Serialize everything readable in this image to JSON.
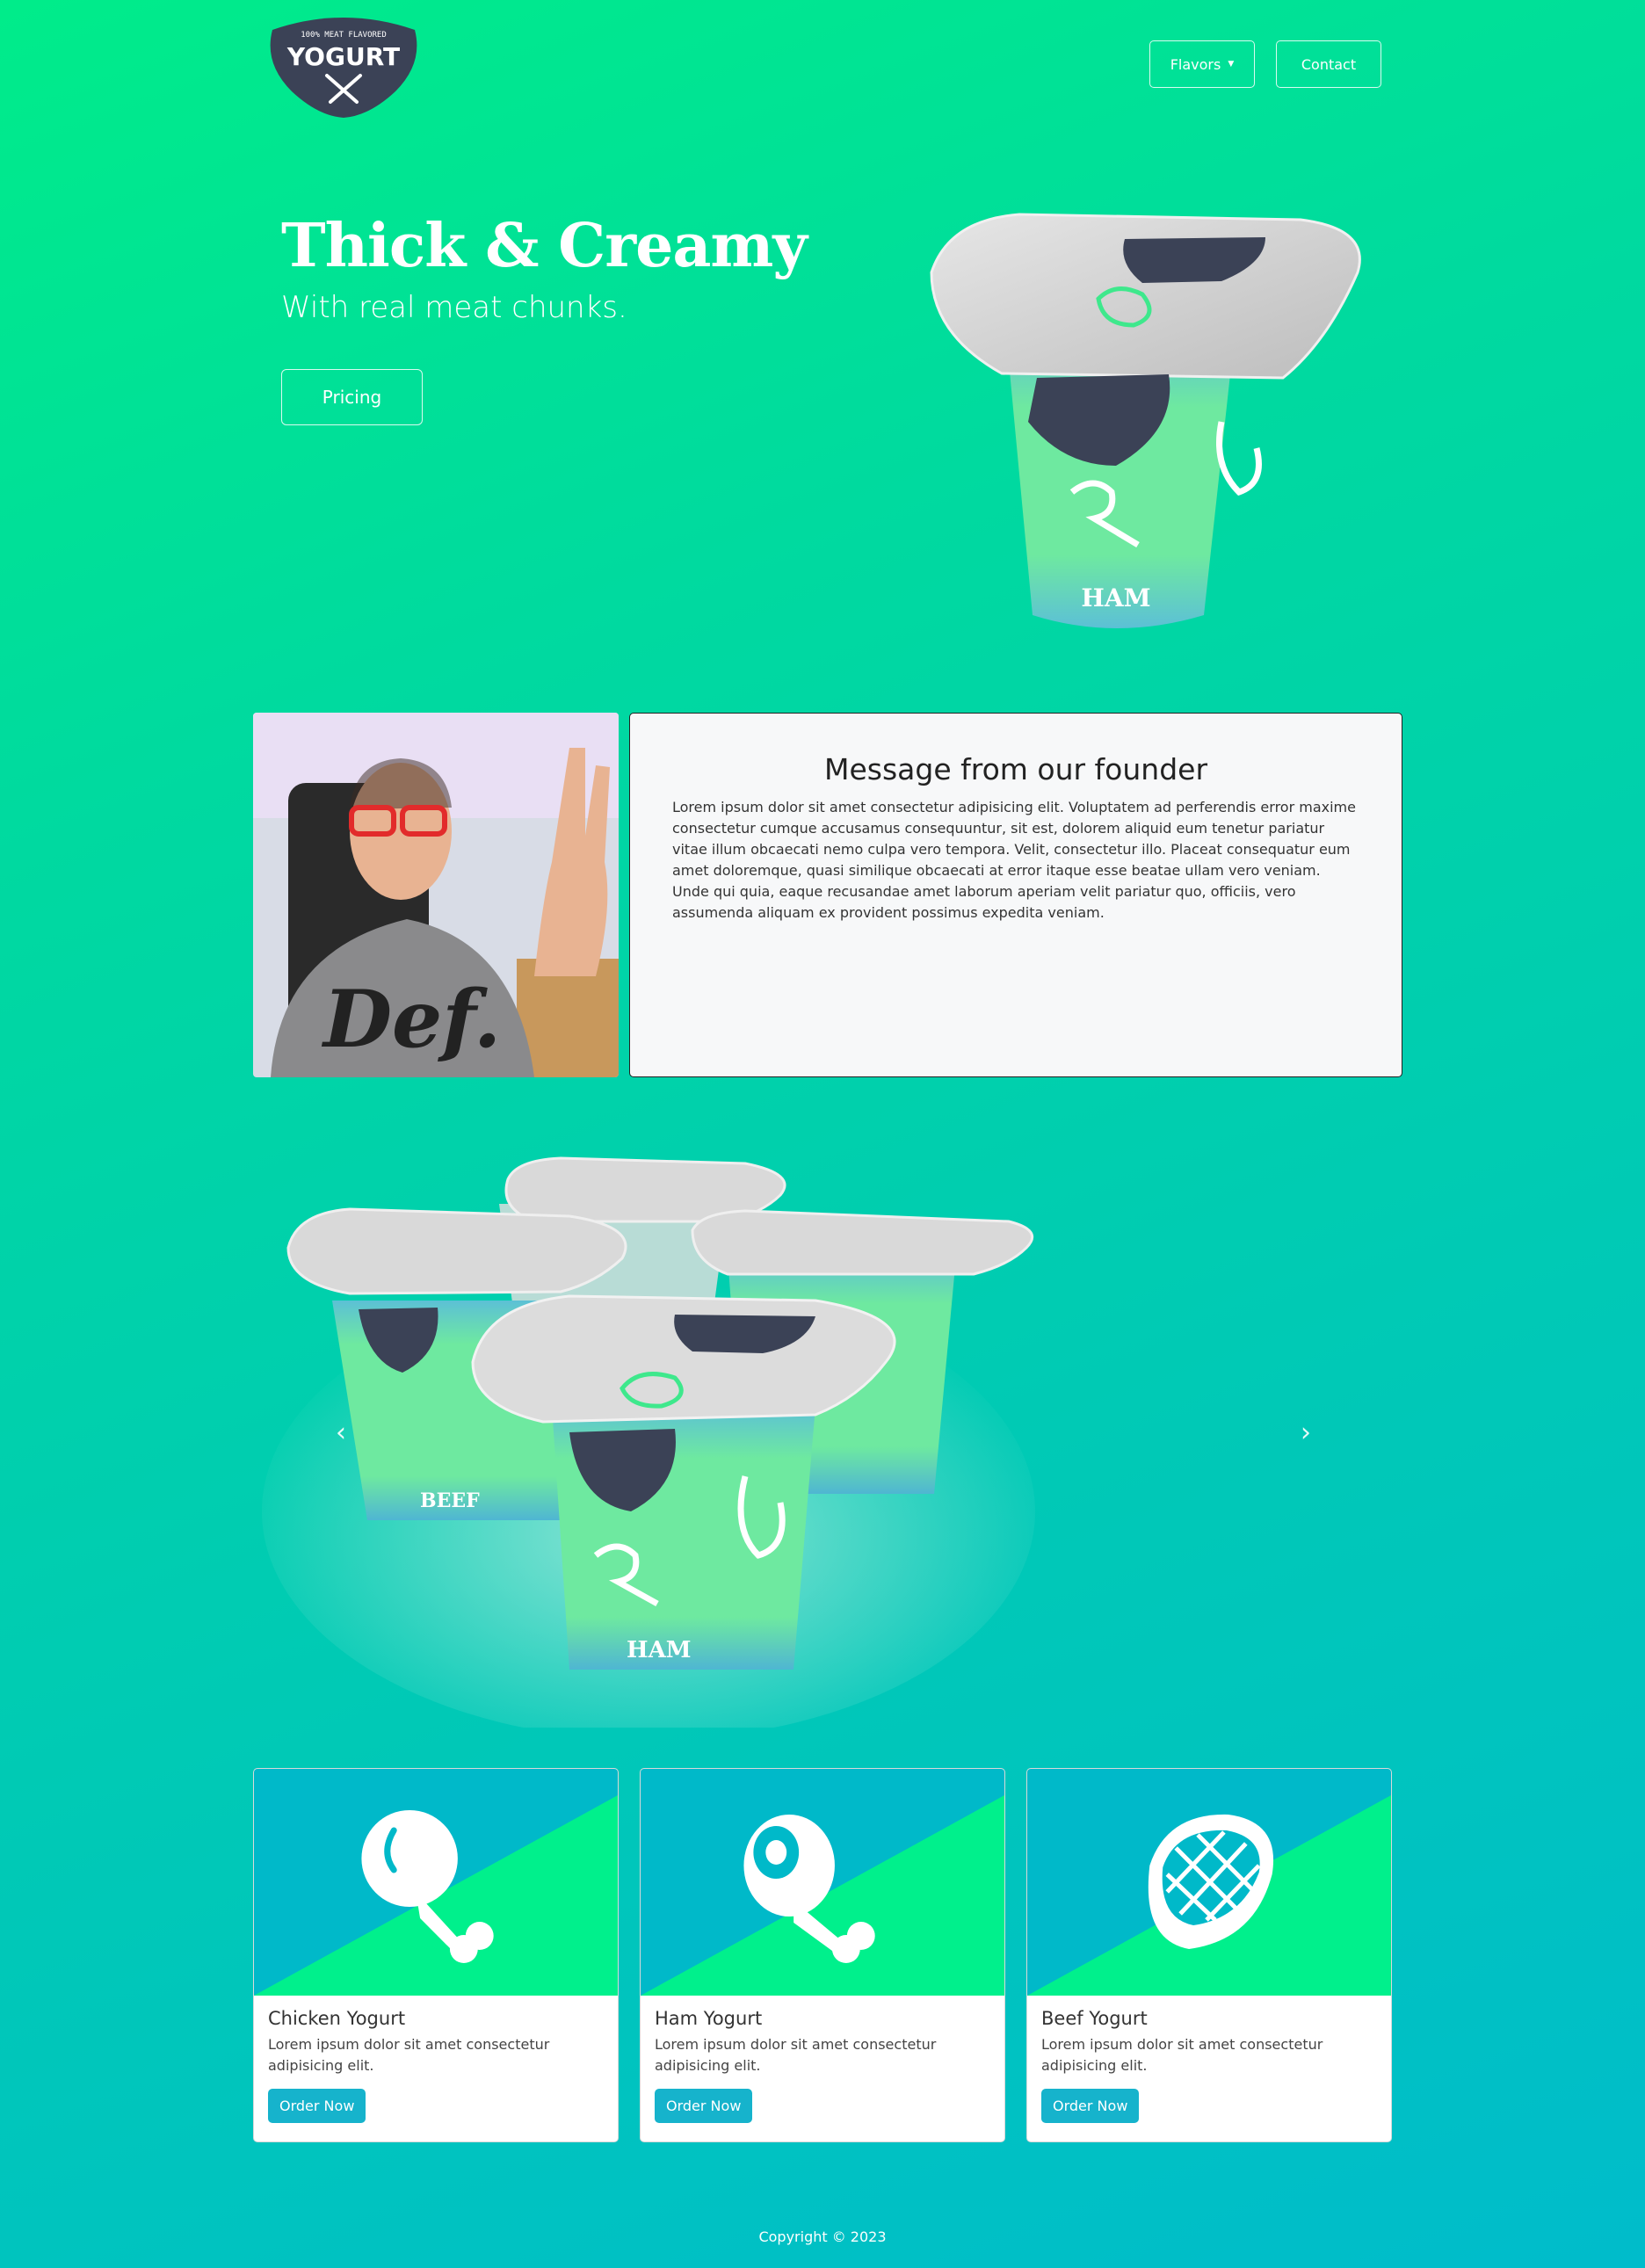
{
  "nav": {
    "logo_top": "100% MEAT FLAVORED",
    "logo_main": "YOGURT",
    "flavors_label": "Flavors",
    "contact_label": "Contact"
  },
  "hero": {
    "title": "Thick & Creamy",
    "subtitle": "With real meat chunks.",
    "pricing_label": "Pricing",
    "cup_label": "HAM"
  },
  "founder": {
    "title": "Message from our founder",
    "text": "Lorem ipsum dolor sit amet consectetur adipisicing elit. Voluptatem ad perferendis error maxime consectetur cumque accusamus consequuntur, sit est, dolorem aliquid eum tenetur pariatur vitae illum obcaecati nemo culpa vero tempora. Velit, consectetur illo. Placeat consequatur eum amet doloremque, quasi similique obcaecati at error itaque esse beatae ullam vero veniam. Unde qui quia, eaque recusandae amet laborum aperiam velit pariatur quo, officiis, vero assumenda aliquam ex provident possimus expedita veniam.",
    "shirt_text": "Def."
  },
  "carousel": {
    "prev_icon": "chevron-left-icon",
    "next_icon": "chevron-right-icon",
    "cup_labels": [
      "BEEF",
      "HAM"
    ]
  },
  "cards": [
    {
      "title": "Chicken Yogurt",
      "text": "Lorem ipsum dolor sit amet consectetur adipisicing elit.",
      "button": "Order Now",
      "icon": "chicken-leg-icon"
    },
    {
      "title": "Ham Yogurt",
      "text": "Lorem ipsum dolor sit amet consectetur adipisicing elit.",
      "button": "Order Now",
      "icon": "ham-icon"
    },
    {
      "title": "Beef Yogurt",
      "text": "Lorem ipsum dolor sit amet consectetur adipisicing elit.",
      "button": "Order Now",
      "icon": "steak-icon"
    }
  ],
  "footer": {
    "copyright": "Copyright © 2023"
  },
  "colors": {
    "bg_top": "#00ec8a",
    "bg_bottom": "#00bccb",
    "accent_button": "#16b3cc",
    "logo_dark": "#3b4256"
  }
}
